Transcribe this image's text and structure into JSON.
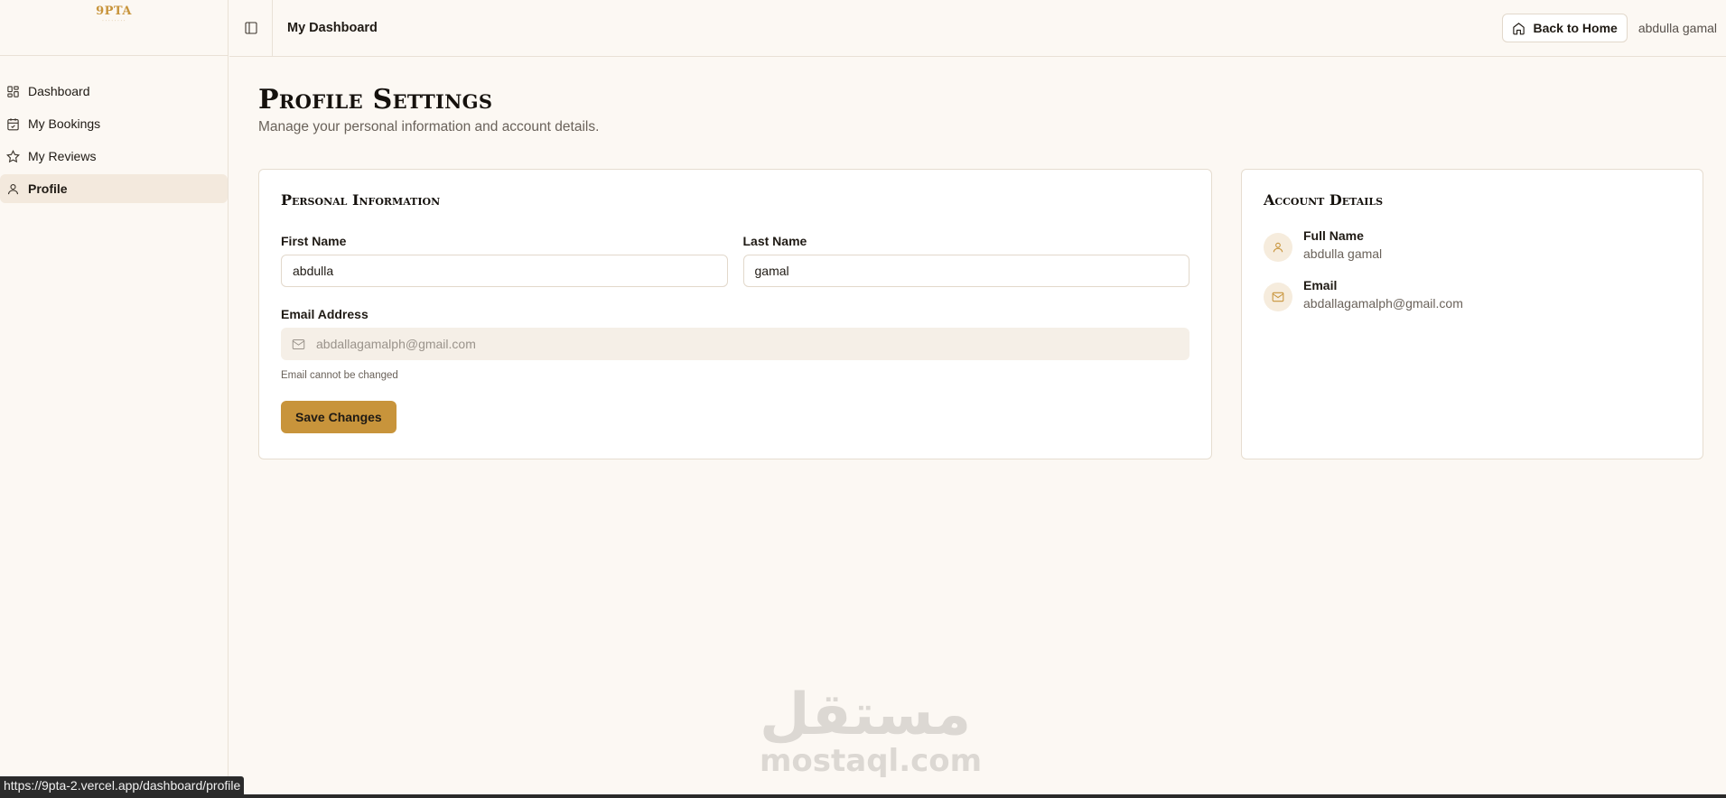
{
  "brand": {
    "logo": "9PTA",
    "tagline": ""
  },
  "sidebar": {
    "items": [
      {
        "label": "Dashboard",
        "icon": "grid-icon",
        "active": false
      },
      {
        "label": "My Bookings",
        "icon": "calendar-check-icon",
        "active": false
      },
      {
        "label": "My Reviews",
        "icon": "star-icon",
        "active": false
      },
      {
        "label": "Profile",
        "icon": "user-icon",
        "active": true
      }
    ]
  },
  "topbar": {
    "title": "My Dashboard",
    "back_label": "Back to Home",
    "user_name": "abdulla gamal"
  },
  "page": {
    "title": "Profile Settings",
    "subtitle": "Manage your personal information and account details."
  },
  "personal": {
    "title": "Personal Information",
    "first_name_label": "First Name",
    "first_name_value": "abdulla",
    "last_name_label": "Last Name",
    "last_name_value": "gamal",
    "email_label": "Email Address",
    "email_value": "abdallagamalph@gmail.com",
    "email_hint": "Email cannot be changed",
    "save_label": "Save Changes"
  },
  "account": {
    "title": "Account Details",
    "full_name_label": "Full Name",
    "full_name_value": "abdulla gamal",
    "email_label": "Email",
    "email_value": "abdallagamalph@gmail.com"
  },
  "watermark": {
    "arabic": "مستقل",
    "latin": "mostaql.com"
  },
  "status_url": "https://9pta-2.vercel.app/dashboard/profile",
  "colors": {
    "accent": "#c8943b",
    "background": "#fcf8f3",
    "active_nav": "#f3e9dd"
  }
}
